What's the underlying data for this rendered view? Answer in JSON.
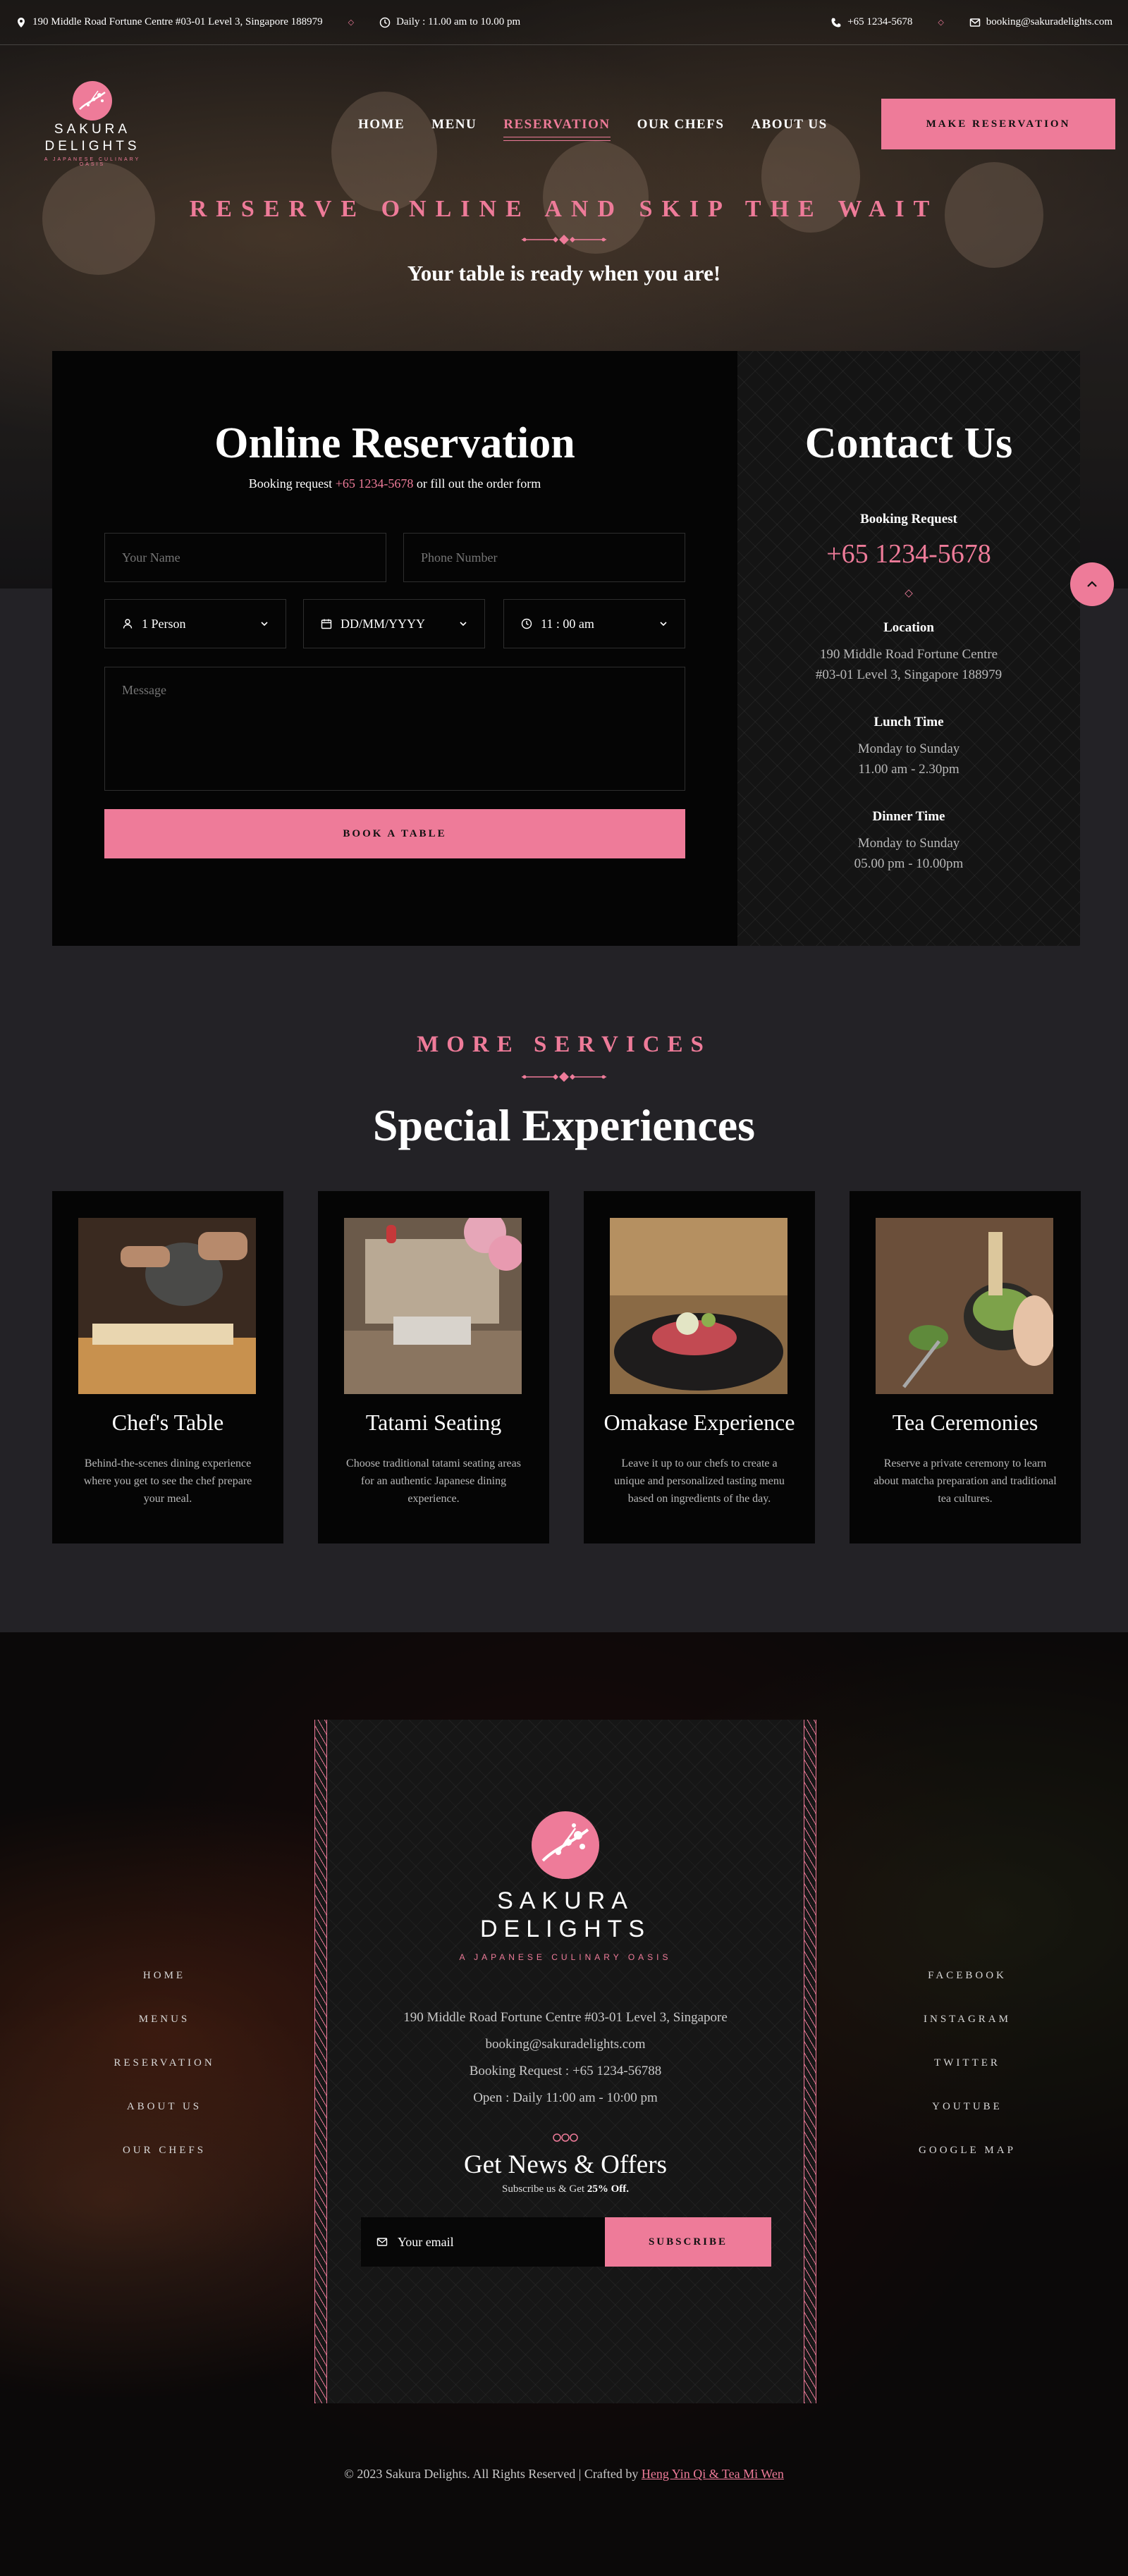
{
  "topbar": {
    "address": "190 Middle Road Fortune Centre #03-01 Level 3, Singapore 188979",
    "hours": "Daily : 11.00 am to 10.00 pm",
    "phone": "+65 1234-5678",
    "email": "booking@sakuradelights.com"
  },
  "brand": {
    "name_line1": "SAKURA",
    "name_line2": "DELIGHTS",
    "tagline": "A JAPANESE CULINARY OASIS"
  },
  "nav": {
    "items": [
      "HOME",
      "MENU",
      "RESERVATION",
      "OUR CHEFS",
      "ABOUT US"
    ],
    "active": "RESERVATION",
    "cta": "MAKE RESERVATION"
  },
  "hero": {
    "eyebrow": "RESERVE ONLINE AND SKIP THE WAIT",
    "subtitle": "Your table is ready when you are!"
  },
  "reservation": {
    "title": "Online Reservation",
    "subtitle_prefix": "Booking request",
    "subtitle_phone": "+65 1234-5678",
    "subtitle_suffix": "or fill out the order form",
    "name_placeholder": "Your Name",
    "phone_placeholder": "Phone Number",
    "guests": "1 Person",
    "date": "DD/MM/YYYY",
    "time": "11 : 00 am",
    "message_placeholder": "Message",
    "submit": "BOOK A TABLE"
  },
  "contact": {
    "title": "Contact Us",
    "booking_label": "Booking Request",
    "booking_phone": "+65 1234-5678",
    "location_label": "Location",
    "location_line1": "190 Middle Road Fortune Centre",
    "location_line2": "#03-01 Level 3, Singapore 188979",
    "lunch_label": "Lunch Time",
    "lunch_days": "Monday to Sunday",
    "lunch_hours": "11.00 am - 2.30pm",
    "dinner_label": "Dinner Time",
    "dinner_days": "Monday to Sunday",
    "dinner_hours": "05.00 pm - 10.00pm"
  },
  "services": {
    "eyebrow": "MORE SERVICES",
    "title": "Special Experiences",
    "cards": [
      {
        "title": "Chef's Table",
        "text": "Behind-the-scenes dining experience where you get to see the chef prepare your meal."
      },
      {
        "title": "Tatami Seating",
        "text": "Choose traditional tatami seating areas for an authentic Japanese dining experience."
      },
      {
        "title": "Omakase Experience",
        "text": "Leave it up to our chefs to create a unique and personalized tasting menu based on ingredients of the day."
      },
      {
        "title": "Tea Ceremonies",
        "text": "Reserve a private ceremony to learn about matcha preparation and traditional tea cultures."
      }
    ]
  },
  "footer": {
    "left_links": [
      "HOME",
      "MENUS",
      "RESERVATION",
      "ABOUT US",
      "OUR CHEFS"
    ],
    "right_links": [
      "FACEBOOK",
      "INSTAGRAM",
      "TWITTER",
      "YOUTUBE",
      "GOOGLE MAP"
    ],
    "address": "190 Middle Road Fortune Centre #03-01 Level 3, Singapore",
    "email": "booking@sakuradelights.com",
    "booking": "Booking Request : +65 1234-56788",
    "open": "Open : Daily 11:00 am - 10:00 pm",
    "news_title": "Get News & Offers",
    "news_sub_prefix": "Subscribe us & Get",
    "news_sub_bold": "25% Off.",
    "email_placeholder": "Your email",
    "subscribe": "SUBSCRIBE",
    "copyright_prefix": "© 2023 Sakura Delights. All Rights Reserved | Crafted by",
    "copyright_credit": "Heng Yin Qi & Tea Mi Wen"
  },
  "colors": {
    "accent": "#ee7b99",
    "panel": "#050505",
    "section_bg": "#232226"
  },
  "icons": [
    "location-icon",
    "clock-icon",
    "phone-icon",
    "mail-icon",
    "user-icon",
    "calendar-icon",
    "chevron-down-icon",
    "arrow-up-icon"
  ]
}
